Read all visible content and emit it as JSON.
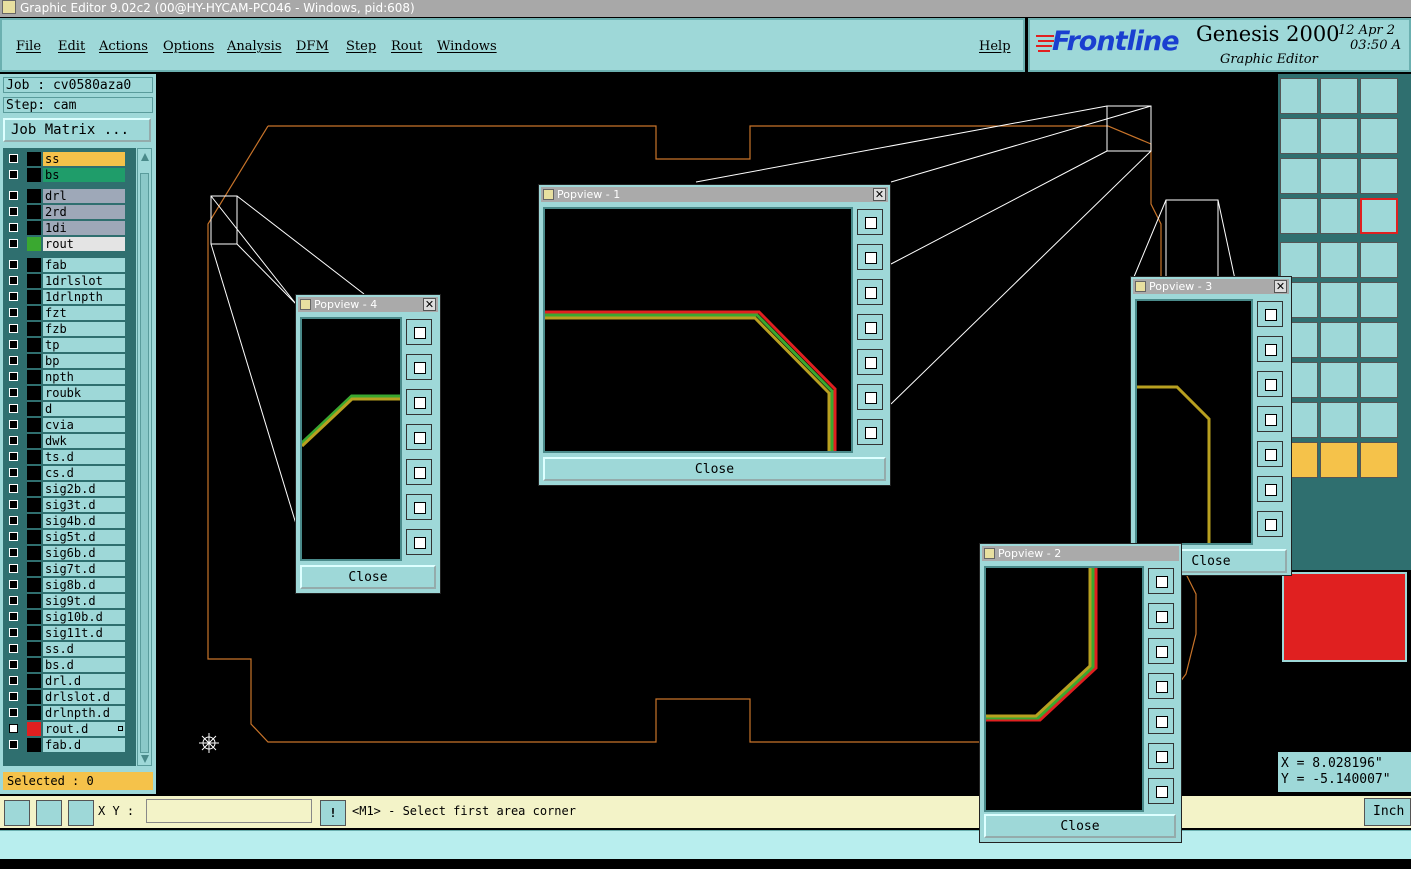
{
  "window": {
    "title": "Graphic Editor 9.02c2 (00@HY-HYCAM-PC046 - Windows, pid:608)"
  },
  "menu": {
    "items": [
      "File",
      "Edit",
      "Actions",
      "Options",
      "Analysis",
      "DFM",
      "Step",
      "Rout",
      "Windows"
    ],
    "help": "Help"
  },
  "brand": {
    "logo": "Frontline",
    "product": "Genesis 2000",
    "subtitle": "Graphic Editor",
    "date": "12 Apr 2",
    "time": "03:50 A"
  },
  "job": {
    "job_label": "Job : cv0580aza0",
    "step_label": "Step: cam",
    "matrix_button": "Job Matrix ..."
  },
  "layers": [
    {
      "name": "ss",
      "color": "#f5c24a",
      "swatch": "#000"
    },
    {
      "name": "bs",
      "color": "#1f9d6a",
      "swatch": "#000"
    },
    {
      "name": "drl",
      "color": "#9ea8b8",
      "swatch": "#000",
      "gap": true
    },
    {
      "name": "2rd",
      "color": "#9ea8b8",
      "swatch": "#000"
    },
    {
      "name": "1di",
      "color": "#9ea8b8",
      "swatch": "#000"
    },
    {
      "name": "rout",
      "color": "#e4e4e4",
      "swatch": "#3aa830"
    },
    {
      "name": "fab",
      "color": "#9ed8d8",
      "swatch": "#000",
      "gap": true
    },
    {
      "name": "1drlslot",
      "color": "#9ed8d8",
      "swatch": "#000"
    },
    {
      "name": "1drlnpth",
      "color": "#9ed8d8",
      "swatch": "#000"
    },
    {
      "name": "fzt",
      "color": "#9ed8d8",
      "swatch": "#000"
    },
    {
      "name": "fzb",
      "color": "#9ed8d8",
      "swatch": "#000"
    },
    {
      "name": "tp",
      "color": "#9ed8d8",
      "swatch": "#000"
    },
    {
      "name": "bp",
      "color": "#9ed8d8",
      "swatch": "#000"
    },
    {
      "name": "npth",
      "color": "#9ed8d8",
      "swatch": "#000"
    },
    {
      "name": "roubk",
      "color": "#9ed8d8",
      "swatch": "#000"
    },
    {
      "name": "d",
      "color": "#9ed8d8",
      "swatch": "#000"
    },
    {
      "name": "cvia",
      "color": "#9ed8d8",
      "swatch": "#000"
    },
    {
      "name": "dwk",
      "color": "#9ed8d8",
      "swatch": "#000"
    },
    {
      "name": "ts.d",
      "color": "#9ed8d8",
      "swatch": "#000"
    },
    {
      "name": "cs.d",
      "color": "#9ed8d8",
      "swatch": "#000"
    },
    {
      "name": "sig2b.d",
      "color": "#9ed8d8",
      "swatch": "#000"
    },
    {
      "name": "sig3t.d",
      "color": "#9ed8d8",
      "swatch": "#000"
    },
    {
      "name": "sig4b.d",
      "color": "#9ed8d8",
      "swatch": "#000"
    },
    {
      "name": "sig5t.d",
      "color": "#9ed8d8",
      "swatch": "#000"
    },
    {
      "name": "sig6b.d",
      "color": "#9ed8d8",
      "swatch": "#000"
    },
    {
      "name": "sig7t.d",
      "color": "#9ed8d8",
      "swatch": "#000"
    },
    {
      "name": "sig8b.d",
      "color": "#9ed8d8",
      "swatch": "#000"
    },
    {
      "name": "sig9t.d",
      "color": "#9ed8d8",
      "swatch": "#000"
    },
    {
      "name": "sig10b.d",
      "color": "#9ed8d8",
      "swatch": "#000"
    },
    {
      "name": "sig11t.d",
      "color": "#9ed8d8",
      "swatch": "#000"
    },
    {
      "name": "ss.d",
      "color": "#9ed8d8",
      "swatch": "#000"
    },
    {
      "name": "bs.d",
      "color": "#9ed8d8",
      "swatch": "#000"
    },
    {
      "name": "drl.d",
      "color": "#9ed8d8",
      "swatch": "#000"
    },
    {
      "name": "drlslot.d",
      "color": "#9ed8d8",
      "swatch": "#000"
    },
    {
      "name": "drlnpth.d",
      "color": "#9ed8d8",
      "swatch": "#000"
    },
    {
      "name": "rout.d",
      "color": "#9ed8d8",
      "swatch": "#e02020",
      "active": true
    },
    {
      "name": "fab.d",
      "color": "#9ed8d8",
      "swatch": "#000"
    }
  ],
  "selected": "Selected : 0",
  "bottom": {
    "xy_label": "X Y :",
    "xy_value": "",
    "message": "<M1> - Select first area corner",
    "units": "Inch"
  },
  "coords": {
    "x": "X = 8.028196\"",
    "y": "Y = -5.140007\""
  },
  "popviews": [
    {
      "title": "Popview - 1",
      "close": "Close"
    },
    {
      "title": "Popview - 2",
      "close": "Close"
    },
    {
      "title": "Popview - 3",
      "close": "Close"
    },
    {
      "title": "Popview - 4",
      "close": "Close"
    }
  ],
  "colors": {
    "panel": "#9ed8d8",
    "outline": "#c8742a",
    "trace_red": "#e02020",
    "trace_gold": "#b8a020",
    "trace_green": "#3aa830"
  }
}
